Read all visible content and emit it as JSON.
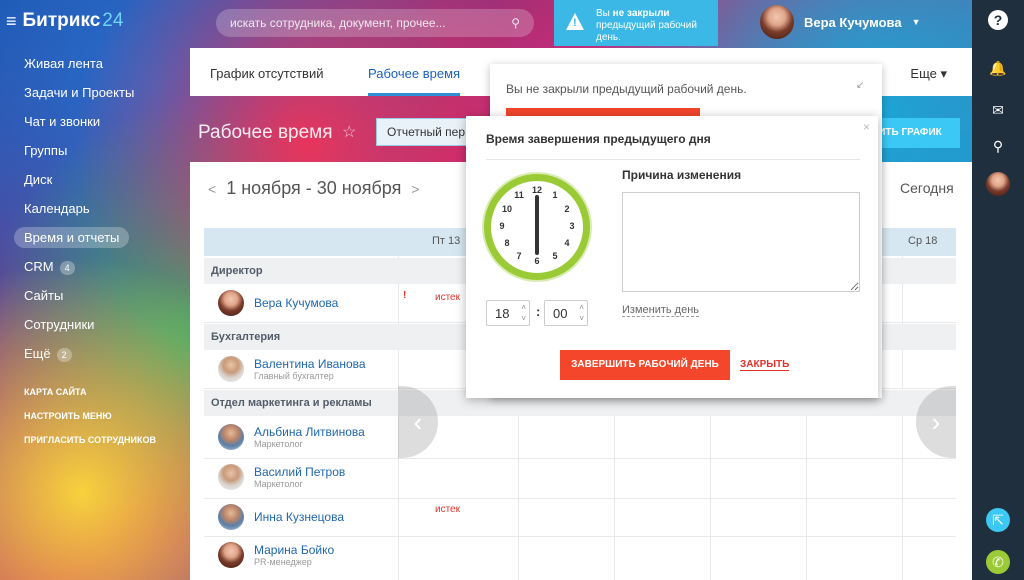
{
  "header": {
    "logo_name": "Битрикс",
    "logo_num": "24",
    "search_placeholder": "искать сотрудника, документ, прочее...",
    "warning_line1_prefix": "Вы ",
    "warning_line1_bold": "не закрыли",
    "warning_line2": "предыдущий рабочий день.",
    "user_name": "Вера Кучумова"
  },
  "left_menu": {
    "items": [
      {
        "label": "Живая лента"
      },
      {
        "label": "Задачи и Проекты"
      },
      {
        "label": "Чат и звонки"
      },
      {
        "label": "Группы"
      },
      {
        "label": "Диск"
      },
      {
        "label": "Календарь"
      },
      {
        "label": "Время и отчеты",
        "active": true
      },
      {
        "label": "CRM",
        "badge": "4"
      },
      {
        "label": "Сайты"
      },
      {
        "label": "Сотрудники"
      },
      {
        "label": "Ещё",
        "badge": "2"
      }
    ],
    "small_links": [
      "КАРТА САЙТА",
      "НАСТРОИТЬ МЕНЮ",
      "ПРИГЛАСИТЬ СОТРУДНИКОВ"
    ]
  },
  "tabs": {
    "absence": "График отсутствий",
    "worktime": "Рабочее время",
    "more": "Еще"
  },
  "page": {
    "title": "Рабочее время",
    "filter": "Отчетный пер",
    "schedule_button": "ИТЬ ГРАФИК"
  },
  "calendar": {
    "range": "1 ноября - 30 ноября",
    "today": "Сегодня",
    "day_fri": "Пт 13",
    "day_wed": "Ср 18",
    "sections": [
      "Директор",
      "Бухгалтерия",
      "Отдел маркетинга и рекламы"
    ],
    "employees": [
      {
        "name": "Вера Кучумова",
        "post": ""
      },
      {
        "name": "Валентина Иванова",
        "post": "Главный бухгалтер"
      },
      {
        "name": "Альбина Литвинова",
        "post": "Маркетолог"
      },
      {
        "name": "Василий Петров",
        "post": "Маркетолог"
      },
      {
        "name": "Инна Кузнецова",
        "post": ""
      },
      {
        "name": "Марина Бойко",
        "post": "PR-менеджер"
      }
    ],
    "expired": "истек",
    "alert_mark": "!"
  },
  "popup_outer": {
    "text": "Вы не закрыли предыдущий рабочий день."
  },
  "popup": {
    "title": "Время завершения предыдущего дня",
    "reason_label": "Причина изменения",
    "hours": "18",
    "minutes": "00",
    "colon": ":",
    "change_day": "Изменить день",
    "finish_button": "ЗАВЕРШИТЬ РАБОЧИЙ ДЕНЬ",
    "close_button": "ЗАКРЫТЬ",
    "clock_numbers": [
      "12",
      "1",
      "2",
      "3",
      "4",
      "5",
      "6",
      "7",
      "8",
      "9",
      "10",
      "11"
    ]
  },
  "icons": {
    "help": "?",
    "bell": "bell-icon",
    "chat": "chat-icon",
    "search": "search-icon",
    "call": "phone-icon",
    "share": "share-icon"
  }
}
